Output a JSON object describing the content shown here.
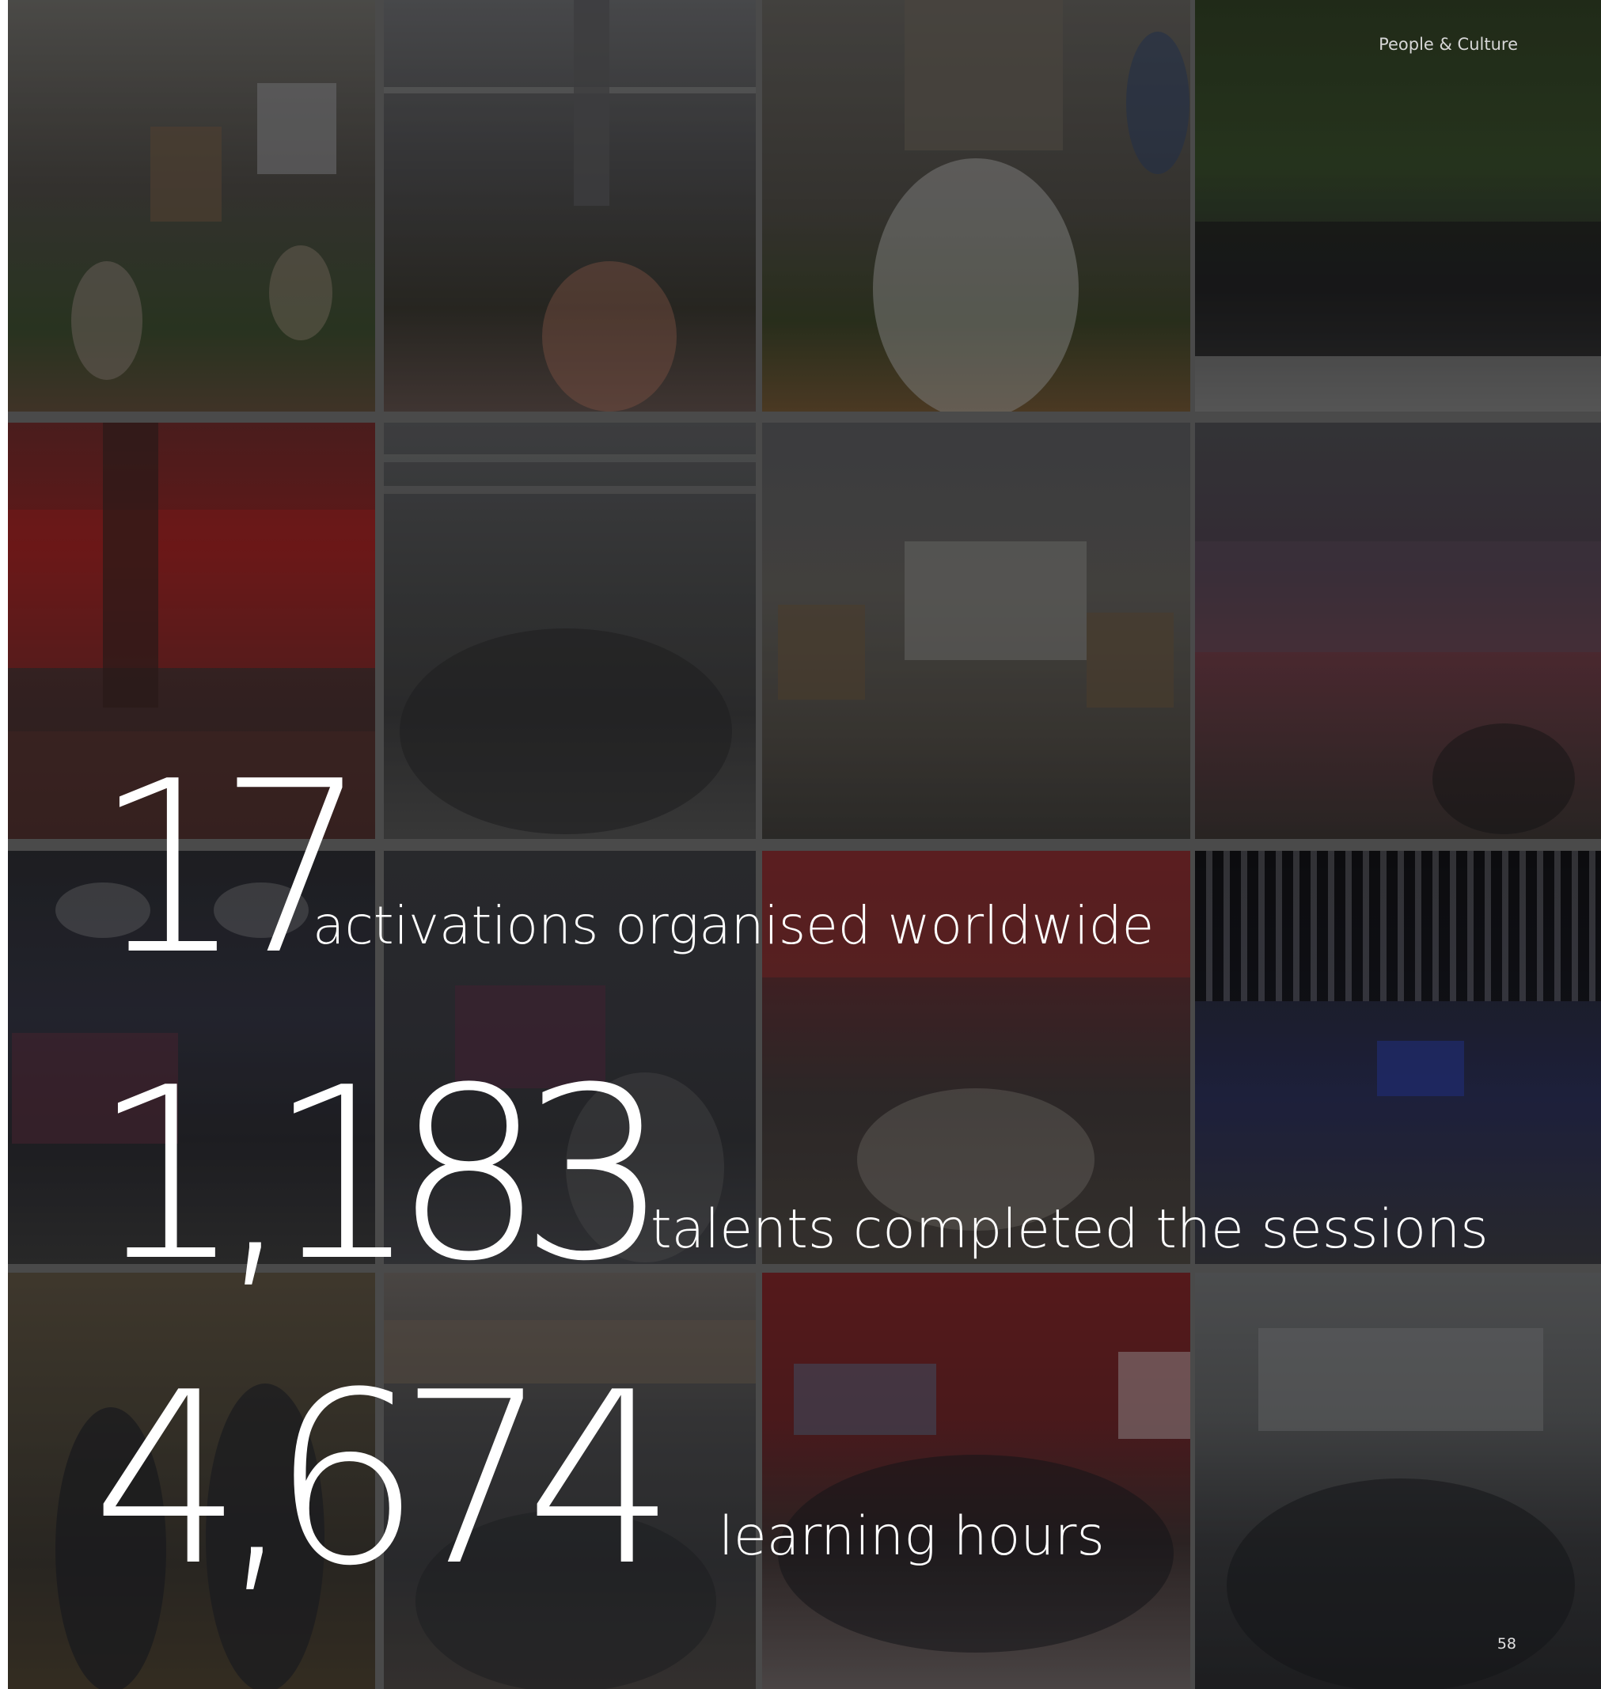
{
  "header": {
    "section_label": "People & Culture"
  },
  "stats": [
    {
      "number": "17",
      "caption": "activations organised worldwide"
    },
    {
      "number": "1,183",
      "caption": "talents completed the sessions"
    },
    {
      "number": "4,674",
      "caption": "learning hours"
    }
  ],
  "footer": {
    "page_number": "58"
  },
  "photos": [
    {
      "name": "photo-audience-seated-floor",
      "tone": "#3d3a36"
    },
    {
      "name": "photo-large-audience-office",
      "tone": "#3a3936"
    },
    {
      "name": "photo-speaker-with-microphone",
      "tone": "#3f3c38"
    },
    {
      "name": "photo-group-green-wall",
      "tone": "#2f3a2c"
    },
    {
      "name": "photo-red-meeting-room",
      "tone": "#5a2424"
    },
    {
      "name": "photo-crowd-office-event",
      "tone": "#37383a"
    },
    {
      "name": "photo-presentation-screen",
      "tone": "#403f3d"
    },
    {
      "name": "photo-lounge-talk",
      "tone": "#3b3540"
    },
    {
      "name": "photo-dark-room-screen",
      "tone": "#2c2d33"
    },
    {
      "name": "photo-seated-session",
      "tone": "#34353a"
    },
    {
      "name": "photo-high-five-team",
      "tone": "#4a2a2c"
    },
    {
      "name": "photo-blue-slatted-hall",
      "tone": "#262a3a"
    },
    {
      "name": "photo-two-people-award",
      "tone": "#3e3a33"
    },
    {
      "name": "photo-warehouse-gathering",
      "tone": "#3a3b3d"
    },
    {
      "name": "photo-group-protect-dignity",
      "tone": "#4b2628"
    },
    {
      "name": "photo-laptop-workshop",
      "tone": "#3c3d3f"
    }
  ]
}
